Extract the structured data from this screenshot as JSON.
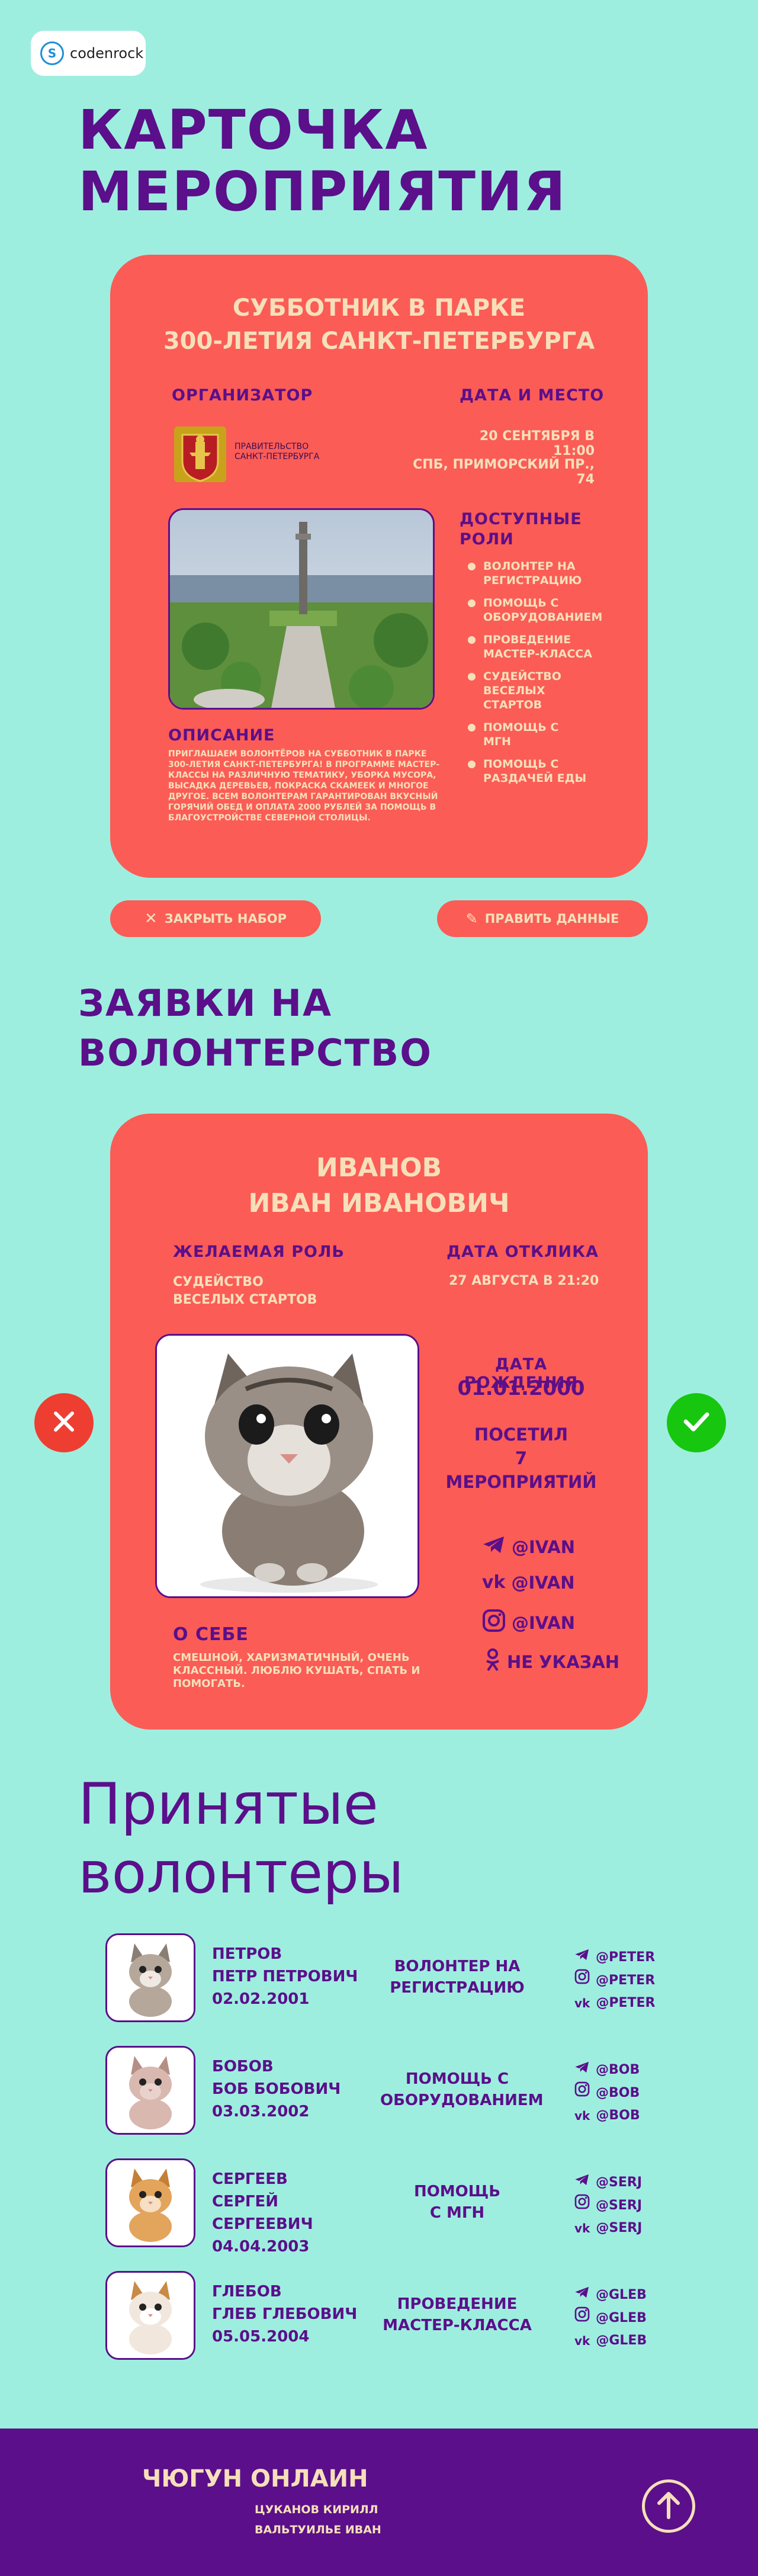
{
  "brand": {
    "logo_text": "codenrock"
  },
  "page_title": {
    "line1": "КАРТОЧКА",
    "line2": "МЕРОПРИЯТИЯ"
  },
  "event": {
    "title_line1": "СУББОТНИК В ПАРКЕ",
    "title_line2": "300-ЛЕТИЯ САНКТ-ПЕТЕРБУРГА",
    "organizer_label": "ОРГАНИЗАТОР",
    "organizer_name_line1": "ПРАВИТЕЛЬСТВО",
    "organizer_name_line2": "САНКТ-ПЕТЕРБУРГА",
    "date_place_label": "ДАТА И МЕСТО",
    "date": "20 СЕНТЯБРЯ В 11:00",
    "place": "СПБ, ПРИМОРСКИЙ ПР., 74",
    "roles_label_line1": "ДОСТУПНЫЕ",
    "roles_label_line2": "РОЛИ",
    "roles": [
      {
        "line1": "ВОЛОНТЕР НА",
        "line2": "РЕГИСТРАЦИЮ"
      },
      {
        "line1": "ПОМОЩЬ С",
        "line2": "ОБОРУДОВАНИЕМ"
      },
      {
        "line1": "ПРОВЕДЕНИЕ",
        "line2": "МАСТЕР-КЛАССА"
      },
      {
        "line1": "СУДЕЙСТВО",
        "line2": "ВЕСЕЛЫХ СТАРТОВ"
      },
      {
        "line1": "ПОМОЩЬ С",
        "line2": "МГН"
      },
      {
        "line1": "ПОМОЩЬ С",
        "line2": "РАЗДАЧЕЙ ЕДЫ"
      }
    ],
    "description_label": "ОПИСАНИЕ",
    "description": "ПРИГЛАШАЕМ ВОЛОНТЁРОВ НА СУББОТНИК В ПАРКЕ 300-ЛЕТИЯ САНКТ-ПЕТЕРБУРГА! В ПРОГРАММЕ МАСТЕР-КЛАССЫ НА РАЗЛИЧНУЮ ТЕМАТИКУ, УБОРКА МУСОРА, ВЫСАДКА ДЕРЕВЬЕВ, ПОКРАСКА СКАМЕЕК И МНОГОЕ ДРУГОЕ. ВСЕМ ВОЛОНТЕРАМ ГАРАНТИРОВАН ВКУСНЫЙ ГОРЯЧИЙ ОБЕД И ОПЛАТА 2000 РУБЛЕЙ ЗА ПОМОЩЬ В БЛАГОУСТРОЙСТВЕ СЕВЕРНОЙ СТОЛИЦЫ."
  },
  "actions": {
    "close_label": "ЗАКРЫТЬ НАБОР",
    "edit_label": "ПРАВИТЬ ДАННЫЕ"
  },
  "applications_title": {
    "line1": "ЗАЯВКИ НА",
    "line2": "ВОЛОНТЕРСТВО"
  },
  "applicant": {
    "surname": "ИВАНОВ",
    "name": "ИВАН ИВАНОВИЧ",
    "role_label": "ЖЕЛАЕМАЯ РОЛЬ",
    "role_line1": "СУДЕЙСТВО",
    "role_line2": "ВЕСЕЛЫХ СТАРТОВ",
    "response_label": "ДАТА ОТКЛИКА",
    "response_date": "27 АВГУСТА В 21:20",
    "birth_label": "ДАТА РОЖДЕНИЯ",
    "birth_date": "01.01.2000",
    "visited_line1": "ПОСЕТИЛ",
    "visited_count": "7",
    "visited_line3": "МЕРОПРИЯТИЙ",
    "telegram": "@IVAN",
    "vk": "@IVAN",
    "instagram": "@IVAN",
    "ok": "НЕ УКАЗАН",
    "about_label": "О СЕБЕ",
    "about": "СМЕШНОЙ, ХАРИЗМАТИЧНЫЙ, ОЧЕНЬ КЛАССНЫЙ. ЛЮБЛЮ КУШАТЬ, СПАТЬ И ПОМОГАТЬ."
  },
  "accepted_title": {
    "line1": "Принятые",
    "line2": "волонтеры"
  },
  "accepted": [
    {
      "surname": "ПЕТРОВ",
      "name": "ПЕТР ПЕТРОВИЧ",
      "birth": "02.02.2001",
      "role_line1": "ВОЛОНТЕР НА",
      "role_line2": "РЕГИСТРАЦИЮ",
      "telegram": "@PETER",
      "instagram": "@PETER",
      "vk": "@PETER",
      "cat": "tabby"
    },
    {
      "surname": "БОБОВ",
      "name": "БОБ БОБОВИЧ",
      "birth": "03.03.2002",
      "role_line1": "ПОМОЩЬ С",
      "role_line2": "ОБОРУДОВАНИЕМ",
      "telegram": "@BOB",
      "instagram": "@BOB",
      "vk": "@BOB",
      "cat": "sphynx"
    },
    {
      "surname": "СЕРГЕЕВ",
      "name": "СЕРГЕЙ СЕРГЕЕВИЧ",
      "birth": "04.04.2003",
      "role_line1": "ПОМОЩЬ",
      "role_line2": "С МГН",
      "telegram": "@SERJ",
      "instagram": "@SERJ",
      "vk": "@SERJ",
      "cat": "ginger"
    },
    {
      "surname": "ГЛЕБОВ",
      "name": "ГЛЕБ ГЛЕБОВИЧ",
      "birth": "05.05.2004",
      "role_line1": "ПРОВЕДЕНИЕ",
      "role_line2": "МАСТЕР-КЛАССА",
      "telegram": "@GLEB",
      "instagram": "@GLEB",
      "vk": "@GLEB",
      "cat": "calico"
    }
  ],
  "footer": {
    "team": "ЧЮГУН ОНЛАИН",
    "member1": "ЦУКАНОВ КИРИЛЛ",
    "member2": "ВАЛЬТУИЛЬЕ ИВАН"
  },
  "colors": {
    "background": "#9eeedf",
    "card": "#fb5c56",
    "accent": "#5b0f8a",
    "text_light": "#f6e0ba",
    "reject": "#ee3e32",
    "accept": "#17c60f"
  },
  "icons": [
    "codenrock-logo-icon",
    "coat-of-arms-icon",
    "close-x-icon",
    "pencil-icon",
    "reject-x-icon",
    "accept-check-icon",
    "telegram-icon",
    "vk-icon",
    "instagram-icon",
    "ok-icon",
    "arrow-up-icon"
  ]
}
